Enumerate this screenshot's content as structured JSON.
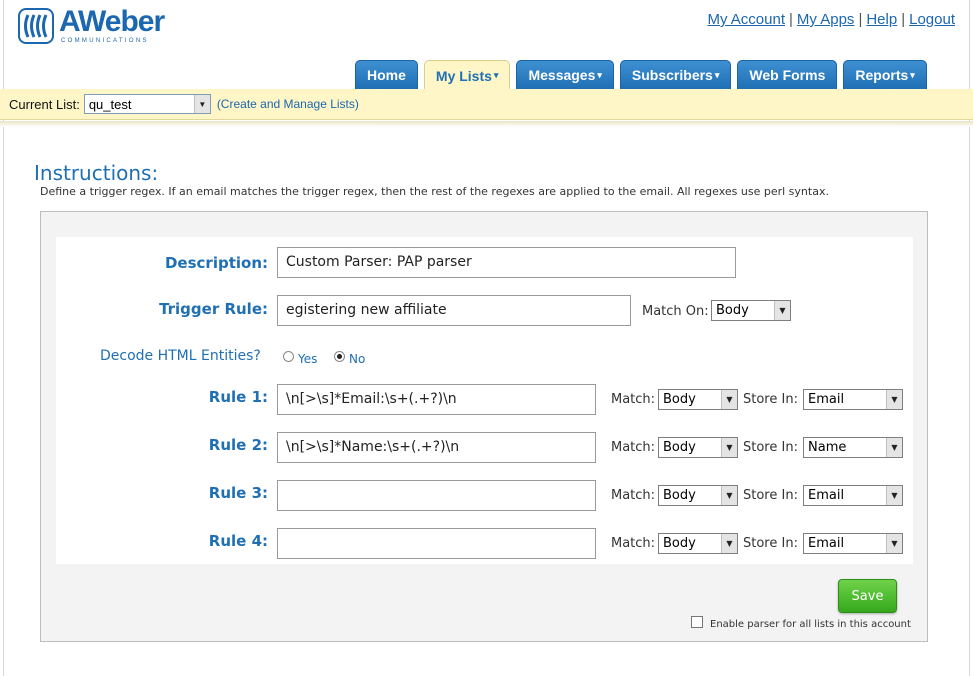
{
  "brand": {
    "name": "AWeber",
    "sub": "COMMUNICATIONS",
    "color": "#1b67b0"
  },
  "toplinks": [
    "My Account",
    "My Apps",
    "Help",
    "Logout"
  ],
  "tabs": [
    {
      "label": "Home",
      "arrow": ""
    },
    {
      "label": "My Lists",
      "arrow": "▾"
    },
    {
      "label": "Messages",
      "arrow": "▾"
    },
    {
      "label": "Subscribers",
      "arrow": "▾"
    },
    {
      "label": "Web Forms",
      "arrow": ""
    },
    {
      "label": "Reports",
      "arrow": "▾"
    }
  ],
  "active_tab": "My Lists",
  "listbar": {
    "label": "Current List:",
    "selected": "qu_test",
    "manage_link": "(Create and Manage Lists)"
  },
  "instructions": {
    "title": "Instructions:",
    "text": "Define a trigger regex. If an email matches the trigger regex, then the rest of the regexes are applied to the email. All regexes use perl syntax."
  },
  "form": {
    "description_label": "Description:",
    "description_value": "Custom Parser: PAP parser",
    "trigger_label": "Trigger Rule:",
    "trigger_value": "egistering new affiliate",
    "match_on_label": "Match On:",
    "match_on_value": "Body",
    "decode_label": "Decode HTML Entities?",
    "decode_yes": "Yes",
    "decode_no": "No",
    "decode_selected": "No",
    "match_label": "Match:",
    "store_label": "Store In:",
    "rules": [
      {
        "label": "Rule 1:",
        "value": "\\n[>\\s]*Email:\\s+(.+?)\\n",
        "match": "Body",
        "store": "Email"
      },
      {
        "label": "Rule 2:",
        "value": "\\n[>\\s]*Name:\\s+(.+?)\\n",
        "match": "Body",
        "store": "Name"
      },
      {
        "label": "Rule 3:",
        "value": "",
        "match": "Body",
        "store": "Email"
      },
      {
        "label": "Rule 4:",
        "value": "",
        "match": "Body",
        "store": "Email"
      }
    ],
    "save_label": "Save",
    "enable_all_label": "Enable parser for all lists in this account"
  },
  "colors": {
    "tab_blue": "#2a7cc4",
    "list_bar": "#fff6c7",
    "save_green": "#4cbc2c",
    "label_blue": "#1f6fb4"
  }
}
